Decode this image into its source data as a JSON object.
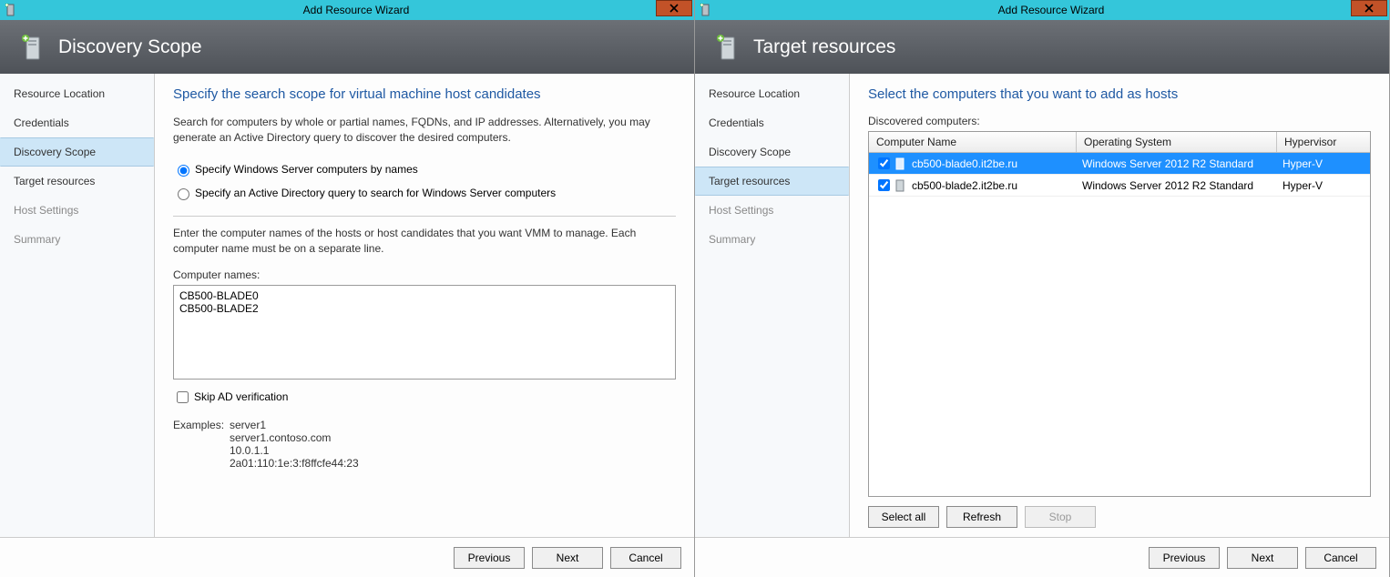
{
  "windows": [
    {
      "title": "Add Resource Wizard",
      "header": "Discovery Scope",
      "sidebar": {
        "items": [
          {
            "label": "Resource Location",
            "active": false,
            "disabled": false
          },
          {
            "label": "Credentials",
            "active": false,
            "disabled": false
          },
          {
            "label": "Discovery Scope",
            "active": true,
            "disabled": false
          },
          {
            "label": "Target resources",
            "active": false,
            "disabled": false
          },
          {
            "label": "Host Settings",
            "active": false,
            "disabled": true
          },
          {
            "label": "Summary",
            "active": false,
            "disabled": true
          }
        ]
      },
      "page": {
        "heading": "Specify the search scope for virtual machine host candidates",
        "desc": "Search for computers by whole or partial names, FQDNs, and IP addresses. Alternatively, you may generate an Active Directory query to discover the desired computers.",
        "radio1": "Specify Windows Server computers by names",
        "radio2": "Specify an Active Directory query to search for Windows Server computers",
        "instr": "Enter the computer names of the hosts or host candidates that you want VMM to manage. Each computer name must be on a separate line.",
        "names_label": "Computer names:",
        "names_value": "CB500-BLADE0\nCB500-BLADE2",
        "skip_ad": "Skip AD verification",
        "examples_label": "Examples:",
        "examples_list": "server1\nserver1.contoso.com\n10.0.1.1\n2a01:110:1e:3:f8ffcfe44:23"
      },
      "footer": {
        "prev": "Previous",
        "next": "Next",
        "cancel": "Cancel"
      }
    },
    {
      "title": "Add Resource Wizard",
      "header": "Target resources",
      "sidebar": {
        "items": [
          {
            "label": "Resource Location",
            "active": false,
            "disabled": false
          },
          {
            "label": "Credentials",
            "active": false,
            "disabled": false
          },
          {
            "label": "Discovery Scope",
            "active": false,
            "disabled": false
          },
          {
            "label": "Target resources",
            "active": true,
            "disabled": false
          },
          {
            "label": "Host Settings",
            "active": false,
            "disabled": true
          },
          {
            "label": "Summary",
            "active": false,
            "disabled": true
          }
        ]
      },
      "page": {
        "heading": "Select the computers that you want to add as hosts",
        "disc_label": "Discovered computers:",
        "columns": [
          "Computer Name",
          "Operating System",
          "Hypervisor"
        ],
        "rows": [
          {
            "checked": true,
            "name": "cb500-blade0.it2be.ru",
            "os": "Windows Server 2012 R2 Standard",
            "hv": "Hyper-V",
            "selected": true
          },
          {
            "checked": true,
            "name": "cb500-blade2.it2be.ru",
            "os": "Windows Server 2012 R2 Standard",
            "hv": "Hyper-V",
            "selected": false
          }
        ],
        "btn_selectall": "Select all",
        "btn_refresh": "Refresh",
        "btn_stop": "Stop"
      },
      "footer": {
        "prev": "Previous",
        "next": "Next",
        "cancel": "Cancel"
      }
    }
  ]
}
